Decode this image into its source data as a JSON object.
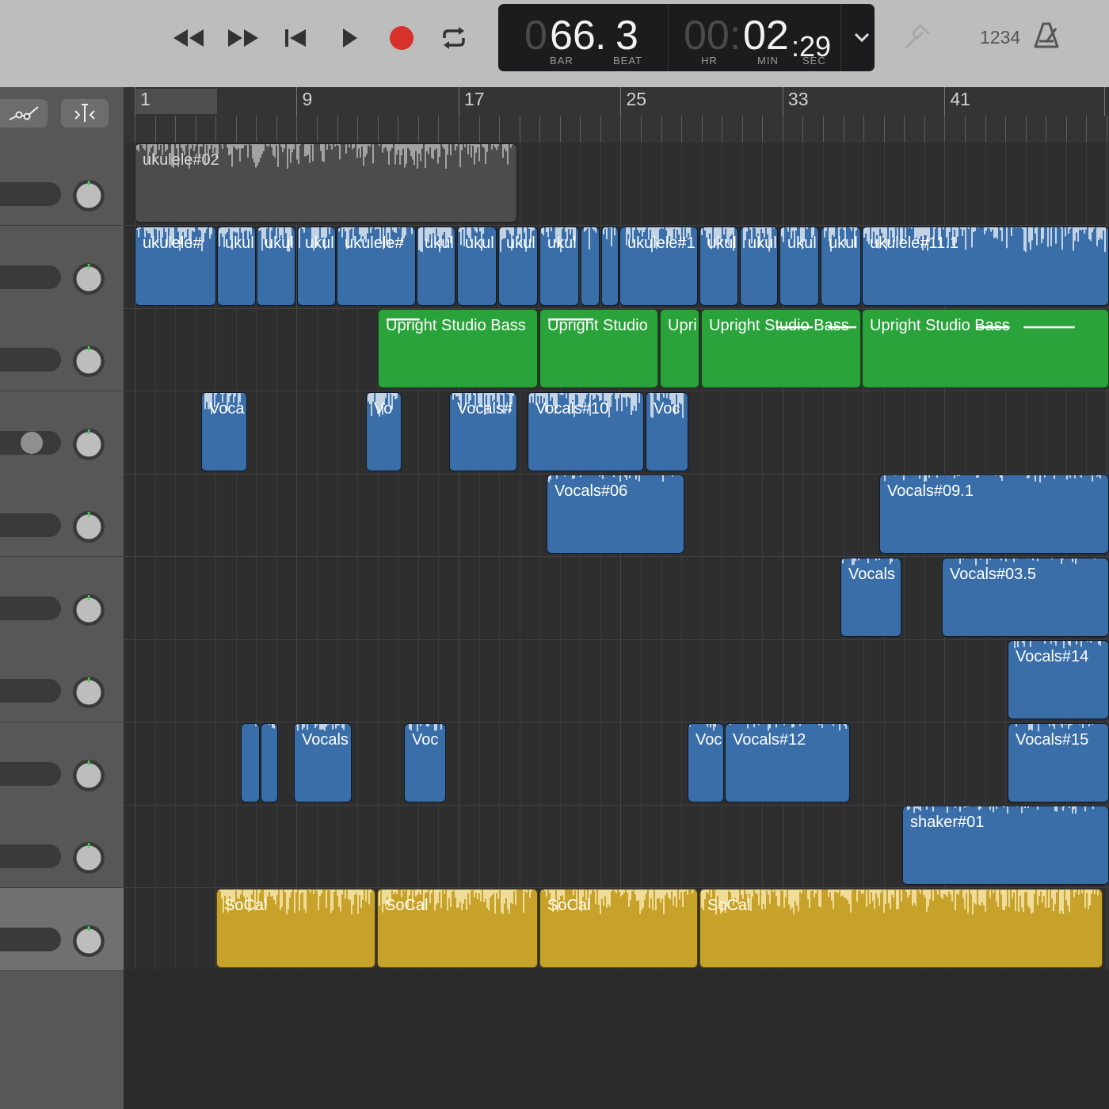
{
  "transport": {
    "buttons": [
      {
        "name": "rewind-button",
        "icon": "rewind-icon"
      },
      {
        "name": "fast-forward-button",
        "icon": "fast-forward-icon"
      },
      {
        "name": "go-to-beginning-button",
        "icon": "skip-back-icon"
      },
      {
        "name": "play-button",
        "icon": "play-icon"
      },
      {
        "name": "record-button",
        "icon": "record-icon"
      },
      {
        "name": "cycle-button",
        "icon": "cycle-icon"
      }
    ],
    "record_color": "#d8302a"
  },
  "lcd": {
    "bar_dim": "0",
    "bar": "66",
    "beat_sep": ".",
    "beat": "3",
    "bar_label": "BAR",
    "beat_label": "BEAT",
    "hr_dim": "00:",
    "min": "02",
    "sec": ":29",
    "hr_label": "HR",
    "min_label": "MIN",
    "sec_label": "SEC"
  },
  "toolbar_right": {
    "count_in": "1234",
    "tuner_icon": "tuning-fork-icon",
    "metronome_icon": "metronome-icon"
  },
  "ruler": {
    "bar_numbers": [
      "1",
      "9",
      "17",
      "25",
      "33",
      "41"
    ]
  },
  "tracks": [
    {
      "regions": [
        {
          "label": "ukulele#02",
          "color": "gray"
        }
      ]
    },
    {
      "regions": [
        {
          "label": "ukulele#"
        },
        {
          "label": "ukul"
        },
        {
          "label": "ukul"
        },
        {
          "label": "ukul"
        },
        {
          "label": "ukulele#"
        },
        {
          "label": "ukul"
        },
        {
          "label": "ukul"
        },
        {
          "label": "ukul"
        },
        {
          "label": "ukul"
        },
        {
          "label": ""
        },
        {
          "label": ""
        },
        {
          "label": "ukulele#1"
        },
        {
          "label": "ukul"
        },
        {
          "label": "ukul"
        },
        {
          "label": "ukul"
        },
        {
          "label": "ukul"
        },
        {
          "label": "ukulele#11.1"
        }
      ]
    },
    {
      "regions": [
        {
          "label": "Upright Studio Bass"
        },
        {
          "label": "Upright Studio"
        },
        {
          "label": "Upri"
        },
        {
          "label": "Upright Studio Bass"
        },
        {
          "label": "Upright Studio Bass"
        }
      ]
    },
    {
      "regions": [
        {
          "label": "Voca"
        },
        {
          "label": "Vo"
        },
        {
          "label": "Vocals#"
        },
        {
          "label": "Vocals#10"
        },
        {
          "label": "Voc"
        }
      ]
    },
    {
      "regions": [
        {
          "label": "Vocals#06"
        },
        {
          "label": "Vocals#09.1"
        }
      ]
    },
    {
      "regions": [
        {
          "label": "Vocals"
        },
        {
          "label": "Vocals#03.5"
        }
      ]
    },
    {
      "regions": [
        {
          "label": "Vocals#14"
        }
      ]
    },
    {
      "regions": [
        {
          "label": ""
        },
        {
          "label": ""
        },
        {
          "label": "Vocals"
        },
        {
          "label": "Voc"
        },
        {
          "label": "Voc"
        },
        {
          "label": "Vocals#12"
        },
        {
          "label": "Vocals#15"
        }
      ]
    },
    {
      "regions": [
        {
          "label": "shaker#01"
        }
      ]
    },
    {
      "regions": [
        {
          "label": "SoCal"
        },
        {
          "label": "SoCal"
        },
        {
          "label": "SoCal"
        },
        {
          "label": "SoCal"
        }
      ]
    }
  ],
  "colors": {
    "audio_region": "#3a6ea8",
    "midi_region": "#2aa33b",
    "drummer_region": "#c7a22a",
    "muted_region": "#4c4c4c"
  }
}
